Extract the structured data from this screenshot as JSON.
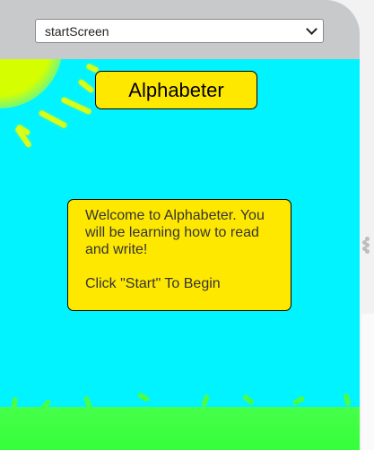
{
  "screen_select": {
    "value": "startScreen",
    "options": [
      "startScreen"
    ]
  },
  "app": {
    "title": "Alphabeter",
    "welcome_message": "Welcome to Alphabeter. You will be learning how to read and write!\n\nClick \"Start\" To Begin"
  },
  "colors": {
    "sky": "#00f3ff",
    "sun": "#d5ff00",
    "grass": "#46ff4a",
    "text_box": "#ffe800",
    "header": "#c8c9cb"
  },
  "icons": [
    "chevron-down-icon",
    "sun-icon",
    "drag-handle-icon"
  ]
}
